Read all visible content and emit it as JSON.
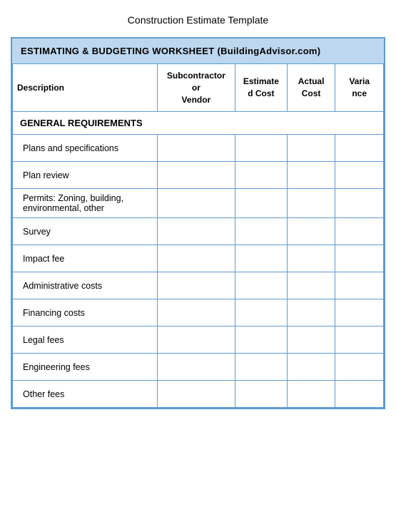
{
  "page": {
    "title": "Construction Estimate Template"
  },
  "header": {
    "label": "ESTIMATING & BUDGETING  WORKSHEET",
    "source": "(BuildingAdvisor.com)"
  },
  "table": {
    "columns": [
      {
        "key": "description",
        "label": "Description"
      },
      {
        "key": "subcontractor",
        "label": "Subcontractor or\nVendor"
      },
      {
        "key": "estimated",
        "label": "Estimated Cost"
      },
      {
        "key": "actual",
        "label": "Actual\nCost"
      },
      {
        "key": "variance",
        "label": "Variance"
      }
    ],
    "section_header": "GENERAL REQUIREMENTS",
    "rows": [
      {
        "description": "Plans and specifications"
      },
      {
        "description": "Plan review"
      },
      {
        "description": "Permits:  Zoning, building,\nenvironmental, other"
      },
      {
        "description": "Survey"
      },
      {
        "description": "Impact fee"
      },
      {
        "description": "Administrative costs"
      },
      {
        "description": "Financing costs"
      },
      {
        "description": "Legal fees"
      },
      {
        "description": "Engineering fees"
      },
      {
        "description": "Other fees"
      }
    ]
  }
}
